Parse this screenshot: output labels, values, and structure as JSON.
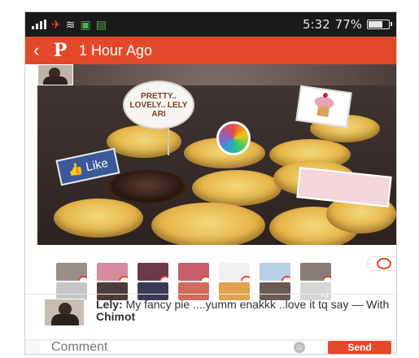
{
  "status_bar": {
    "time": "5:32",
    "battery_percent": "77%",
    "battery_level": 0.77
  },
  "header": {
    "title": "1 Hour Ago",
    "back_icon": "chevron-left-icon",
    "logo_icon": "pinterest-logo-icon"
  },
  "photo": {
    "tag_round": "PRETTY.. LOVELY.. LELY ARI",
    "tag_like": "Like",
    "tag_banner": "Banner",
    "colors": {
      "brand": "#e2492a"
    }
  },
  "likers": {
    "more_count": "+4"
  },
  "caption": {
    "user": "Lely:",
    "text": "My fancy pie ....yumm enakkk ..love it tq say —",
    "with_label": "With",
    "with_user": "Chimot"
  },
  "comment_bar": {
    "placeholder": "Comment",
    "send_label": "Send"
  }
}
